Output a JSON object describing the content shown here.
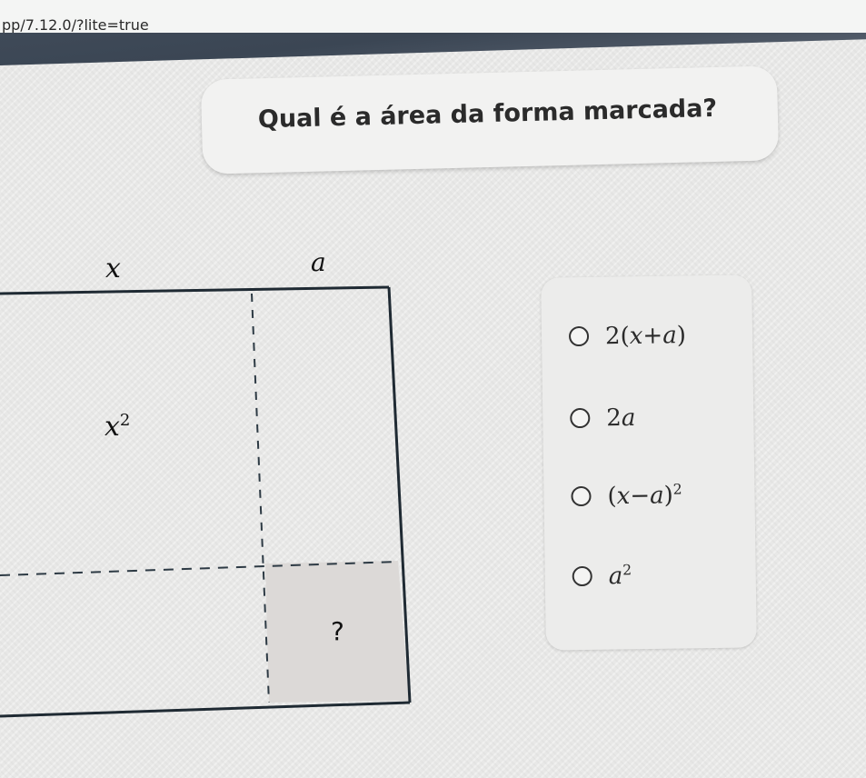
{
  "browser": {
    "url": "pp/7.12.0/?lite=true"
  },
  "question": {
    "text": "Qual é a área da forma marcada?"
  },
  "figure": {
    "label_top_left": "x",
    "label_top_right": "a",
    "label_inner": "x",
    "label_inner_exp": "2",
    "label_marked": "?",
    "marked_fill": "#dcd9d7",
    "line_color": "#1f2a33"
  },
  "options": [
    {
      "prefix": "2(",
      "var1": "x",
      "op": "+",
      "var2": "a",
      "suffix": ")",
      "exp": ""
    },
    {
      "prefix": "2",
      "var1": "a",
      "op": "",
      "var2": "",
      "suffix": "",
      "exp": ""
    },
    {
      "prefix": "(",
      "var1": "x",
      "op": "−",
      "var2": "a",
      "suffix": ")",
      "exp": "2"
    },
    {
      "prefix": "",
      "var1": "a",
      "op": "",
      "var2": "",
      "suffix": "",
      "exp": "2"
    }
  ],
  "colors": {
    "toolbar": "#3f4a58",
    "card": "#f2f2f1",
    "text": "#2b2b2b"
  }
}
